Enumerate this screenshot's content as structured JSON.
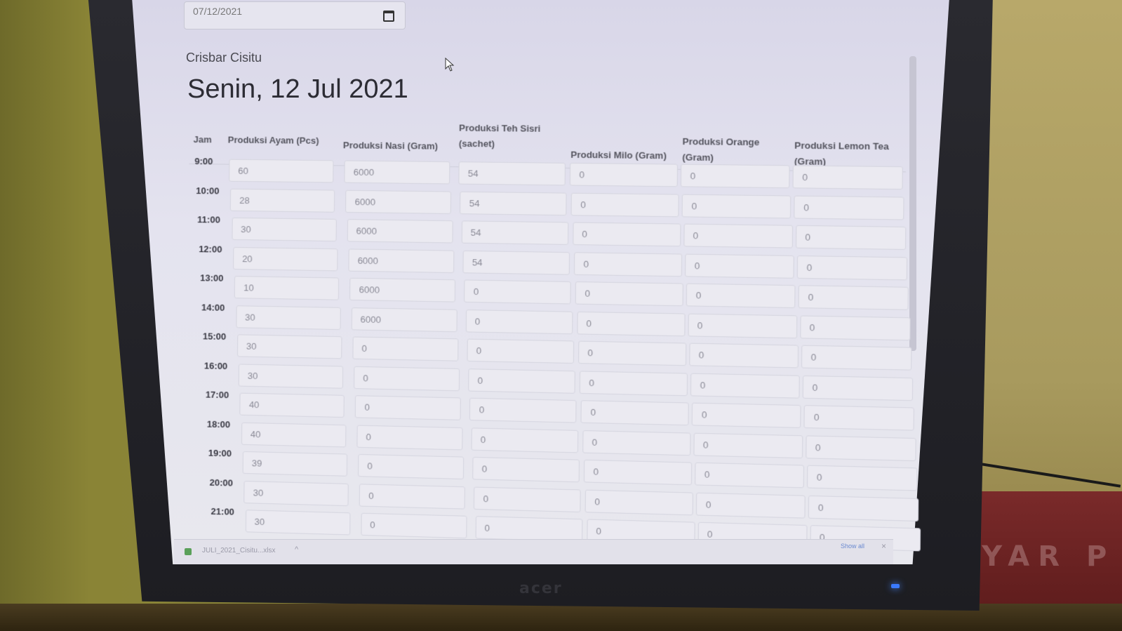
{
  "date_picker": {
    "value": "07/12/2021"
  },
  "location": "Crisbar Cisitu",
  "title": "Senin, 12 Jul 2021",
  "table": {
    "headers": [
      [
        "Jam"
      ],
      [
        "Produksi Ayam (Pcs)"
      ],
      [
        "Produksi Nasi (Gram)"
      ],
      [
        "Produksi Teh Sisri",
        "(sachet)"
      ],
      [
        "Produksi Milo (Gram)"
      ],
      [
        "Produksi Orange",
        "(Gram)"
      ],
      [
        "Produksi Lemon Tea",
        "(Gram)"
      ]
    ],
    "rows": [
      {
        "jam": "9:00",
        "values": [
          "60",
          "6000",
          "54",
          "0",
          "0",
          "0"
        ]
      },
      {
        "jam": "10:00",
        "values": [
          "28",
          "6000",
          "54",
          "0",
          "0",
          "0"
        ]
      },
      {
        "jam": "11:00",
        "values": [
          "30",
          "6000",
          "54",
          "0",
          "0",
          "0"
        ]
      },
      {
        "jam": "12:00",
        "values": [
          "20",
          "6000",
          "54",
          "0",
          "0",
          "0"
        ]
      },
      {
        "jam": "13:00",
        "values": [
          "10",
          "6000",
          "0",
          "0",
          "0",
          "0"
        ]
      },
      {
        "jam": "14:00",
        "values": [
          "30",
          "6000",
          "0",
          "0",
          "0",
          "0"
        ]
      },
      {
        "jam": "15:00",
        "values": [
          "30",
          "0",
          "0",
          "0",
          "0",
          "0"
        ]
      },
      {
        "jam": "16:00",
        "values": [
          "30",
          "0",
          "0",
          "0",
          "0",
          "0"
        ]
      },
      {
        "jam": "17:00",
        "values": [
          "40",
          "0",
          "0",
          "0",
          "0",
          "0"
        ]
      },
      {
        "jam": "18:00",
        "values": [
          "40",
          "0",
          "0",
          "0",
          "0",
          "0"
        ]
      },
      {
        "jam": "19:00",
        "values": [
          "39",
          "0",
          "0",
          "0",
          "0",
          "0"
        ]
      },
      {
        "jam": "20:00",
        "values": [
          "30",
          "0",
          "0",
          "0",
          "0",
          "0"
        ]
      },
      {
        "jam": "21:00",
        "values": [
          "30",
          "0",
          "0",
          "0",
          "0",
          "0"
        ]
      }
    ]
  },
  "download_bar": {
    "file_name": "JULI_2021_Cisitu...xlsx",
    "chevron": "^",
    "show_all": "Show all",
    "close": "×"
  },
  "monitor": {
    "brand": "acer"
  },
  "background_box_text": "AYAR P"
}
